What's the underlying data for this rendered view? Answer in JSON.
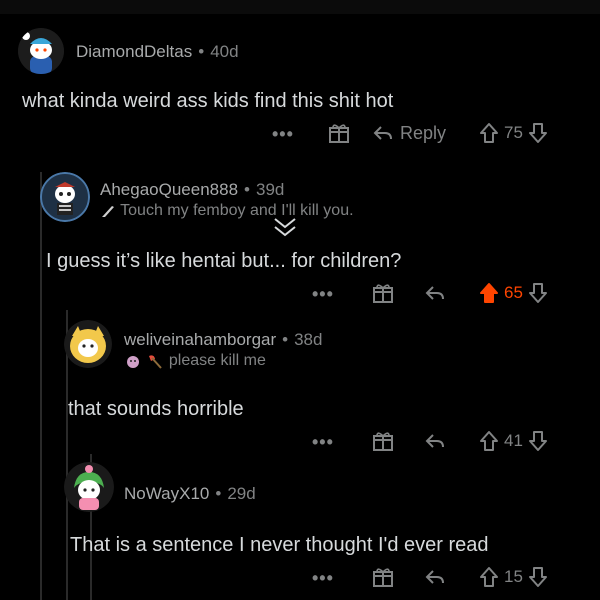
{
  "comments": [
    {
      "username": "DiamondDeltas",
      "age": "40d",
      "flair": "",
      "body": "what kinda weird ass kids find this shit hot",
      "reply_label": "Reply",
      "score": "75",
      "upvoted": false
    },
    {
      "username": "AhegaoQueen888",
      "age": "39d",
      "flair": "Touch my femboy and I'll kill you.",
      "body": "I guess it’s like hentai but... for children?",
      "reply_label": "",
      "score": "65",
      "upvoted": true
    },
    {
      "username": "weliveinahamborgar",
      "age": "38d",
      "flair": "please kill me",
      "body": "that sounds horrible",
      "reply_label": "",
      "score": "41",
      "upvoted": false
    },
    {
      "username": "NoWayX10",
      "age": "29d",
      "flair": "",
      "body": "That is a sentence I never thought I'd ever read",
      "reply_label": "",
      "score": "15",
      "upvoted": false
    }
  ],
  "more_options_label": "•••",
  "colors": {
    "background": "#000000",
    "text": "#d7dadc",
    "muted": "#818384",
    "upvote_active": "#ff4500"
  },
  "icons": [
    "more-options-icon",
    "award-icon",
    "reply-icon",
    "upvote-icon",
    "downvote-icon",
    "collapse-chevron-icon"
  ]
}
